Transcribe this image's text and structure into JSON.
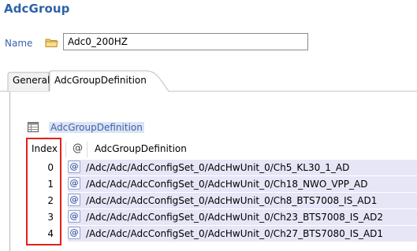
{
  "title": "AdcGroup",
  "name_field": {
    "label": "Name",
    "value": "Adc0_200HZ"
  },
  "tabs": [
    {
      "label": "General",
      "active": false
    },
    {
      "label": "AdcGroupDefinition",
      "active": true
    }
  ],
  "section": {
    "link_label": "AdcGroupDefinition"
  },
  "table": {
    "columns": [
      "Index",
      "@",
      "AdcGroupDefinition"
    ],
    "rows": [
      {
        "index": "0",
        "path": "/Adc/Adc/AdcConfigSet_0/AdcHwUnit_0/Ch5_KL30_1_AD"
      },
      {
        "index": "1",
        "path": "/Adc/Adc/AdcConfigSet_0/AdcHwUnit_0/Ch18_NWO_VPP_AD"
      },
      {
        "index": "2",
        "path": "/Adc/Adc/AdcConfigSet_0/AdcHwUnit_0/Ch8_BTS7008_IS_AD1"
      },
      {
        "index": "3",
        "path": "/Adc/Adc/AdcConfigSet_0/AdcHwUnit_0/Ch23_BTS7008_IS_AD2"
      },
      {
        "index": "4",
        "path": "/Adc/Adc/AdcConfigSet_0/AdcHwUnit_0/Ch27_BTS7080_IS_AD1"
      }
    ],
    "row_icon": "@"
  },
  "colors": {
    "title": "#2d62a8",
    "link": "#3a62b2",
    "row_band": "#e6e6f7",
    "highlight_box": "#e0221c"
  },
  "icons": {
    "name_field_icon": "folder-icon",
    "section_icon": "table-icon",
    "row_icon": "reference-icon"
  }
}
